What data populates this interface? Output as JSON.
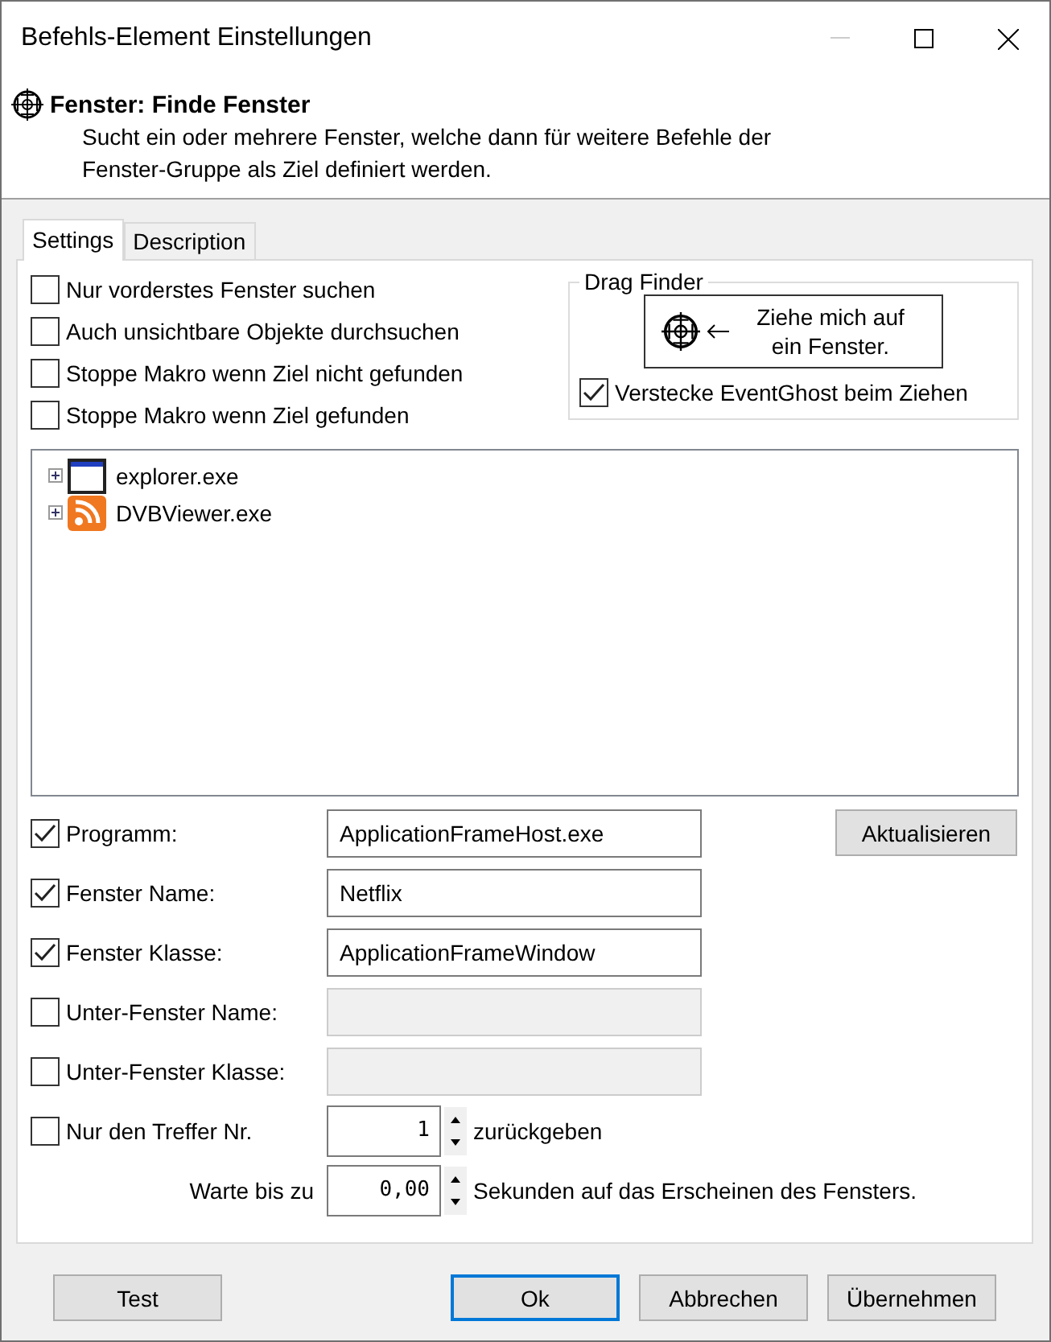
{
  "window": {
    "title": "Befehls-Element Einstellungen"
  },
  "header": {
    "title": "Fenster: Finde Fenster",
    "description_lines": [
      "Sucht ein oder mehrere Fenster, welche dann für weitere Befehle der",
      "Fenster-Gruppe als Ziel definiert werden."
    ]
  },
  "tabs": [
    {
      "label": "Settings",
      "selected": true
    },
    {
      "label": "Description",
      "selected": false
    }
  ],
  "options": [
    {
      "label": "Nur vorderstes Fenster suchen",
      "checked": false
    },
    {
      "label": "Auch unsichtbare Objekte durchsuchen",
      "checked": false
    },
    {
      "label": "Stoppe Makro wenn Ziel nicht gefunden",
      "checked": false
    },
    {
      "label": "Stoppe Makro wenn Ziel gefunden",
      "checked": false
    }
  ],
  "drag_finder": {
    "title": "Drag Finder",
    "button_lines": [
      "Ziehe mich auf",
      "ein Fenster."
    ],
    "hide_option": {
      "label": "Verstecke EventGhost beim Ziehen",
      "checked": true
    }
  },
  "tree": [
    {
      "label": "explorer.exe",
      "kind": "window",
      "expanded": false
    },
    {
      "label": "DVBViewer.exe",
      "kind": "feed",
      "expanded": false
    }
  ],
  "fields": [
    {
      "label": "Programm:",
      "checked": true,
      "value": "ApplicationFrameHost.exe",
      "disabled": false
    },
    {
      "label": "Fenster Name:",
      "checked": true,
      "value": "Netflix",
      "disabled": false
    },
    {
      "label": "Fenster Klasse:",
      "checked": true,
      "value": "ApplicationFrameWindow",
      "disabled": false
    },
    {
      "label": "Unter-Fenster Name:",
      "checked": false,
      "disabled": true
    },
    {
      "label": "Unter-Fenster Klasse:",
      "checked": false,
      "disabled": true
    }
  ],
  "refresh_button": "Aktualisieren",
  "match_row": {
    "label": "Nur den Treffer Nr.",
    "checked": false,
    "value": "1",
    "suffix": "zurückgeben"
  },
  "wait_row": {
    "label": "Warte bis zu",
    "value": "0,00",
    "suffix": "Sekunden auf das Erscheinen des Fensters."
  },
  "buttons": [
    {
      "label": "Test",
      "default": false
    },
    {
      "label": "Ok",
      "default": true
    },
    {
      "label": "Abbrechen",
      "default": false
    },
    {
      "label": "Übernehmen",
      "default": false
    }
  ]
}
